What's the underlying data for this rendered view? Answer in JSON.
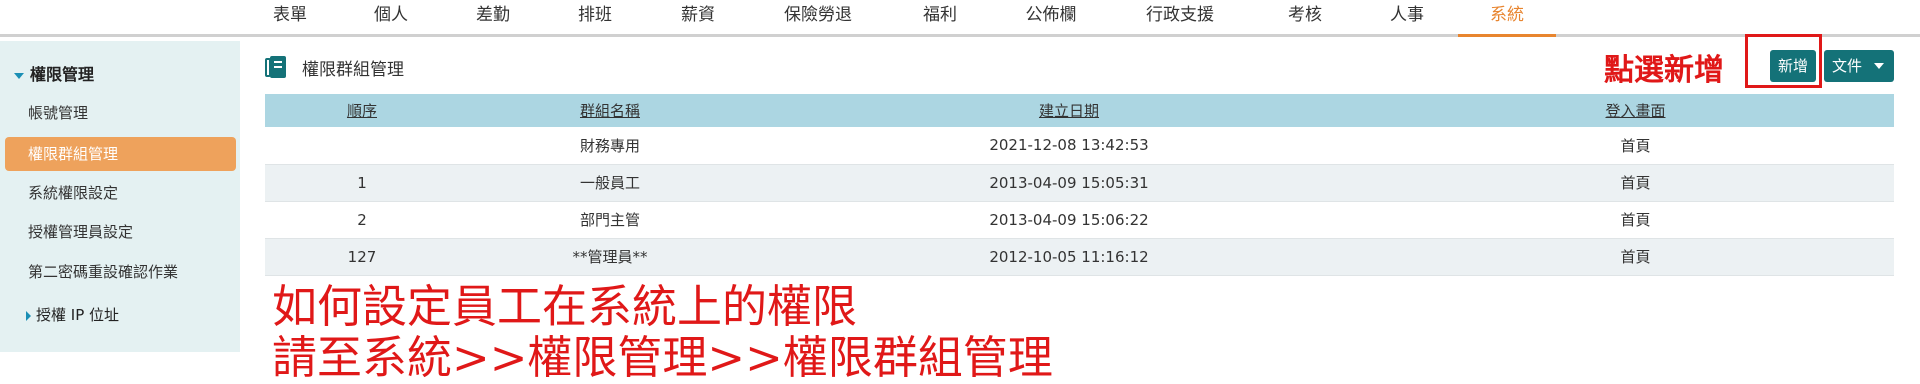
{
  "topnav": {
    "items": [
      "表單",
      "個人",
      "差勤",
      "排班",
      "薪資",
      "保險勞退",
      "福利",
      "公佈欄",
      "行政支援",
      "考核",
      "人事",
      "系統"
    ],
    "active": "系統"
  },
  "sidebar": {
    "section": "權限管理",
    "items": [
      "帳號管理",
      "權限群組管理",
      "系統權限設定",
      "授權管理員設定",
      "第二密碼重設確認作業"
    ],
    "active": "權限群組管理",
    "ip_item": "授權 IP 位址"
  },
  "page": {
    "title": "權限群組管理"
  },
  "toolbar": {
    "add_label": "新增",
    "doc_label": "文件"
  },
  "annotations": {
    "top": "點選新增",
    "line1": "如何設定員工在系統上的權限",
    "line2": "請至系統>>權限管理>>權限群組管理"
  },
  "table": {
    "headers": [
      "順序",
      "群組名稱",
      "建立日期",
      "登入畫面"
    ],
    "rows": [
      [
        "",
        "財務專用",
        "2021-12-08 13:42:53",
        "首頁"
      ],
      [
        "1",
        "一般員工",
        "2013-04-09 15:05:31",
        "首頁"
      ],
      [
        "2",
        "部門主管",
        "2013-04-09 15:06:22",
        "首頁"
      ],
      [
        "127",
        "**管理員**",
        "2012-10-05 11:16:12",
        "首頁"
      ]
    ]
  },
  "colors": {
    "accent": "#e8852f",
    "button": "#147278",
    "header_bg": "#acd6e2",
    "annotation": "#e01818"
  }
}
